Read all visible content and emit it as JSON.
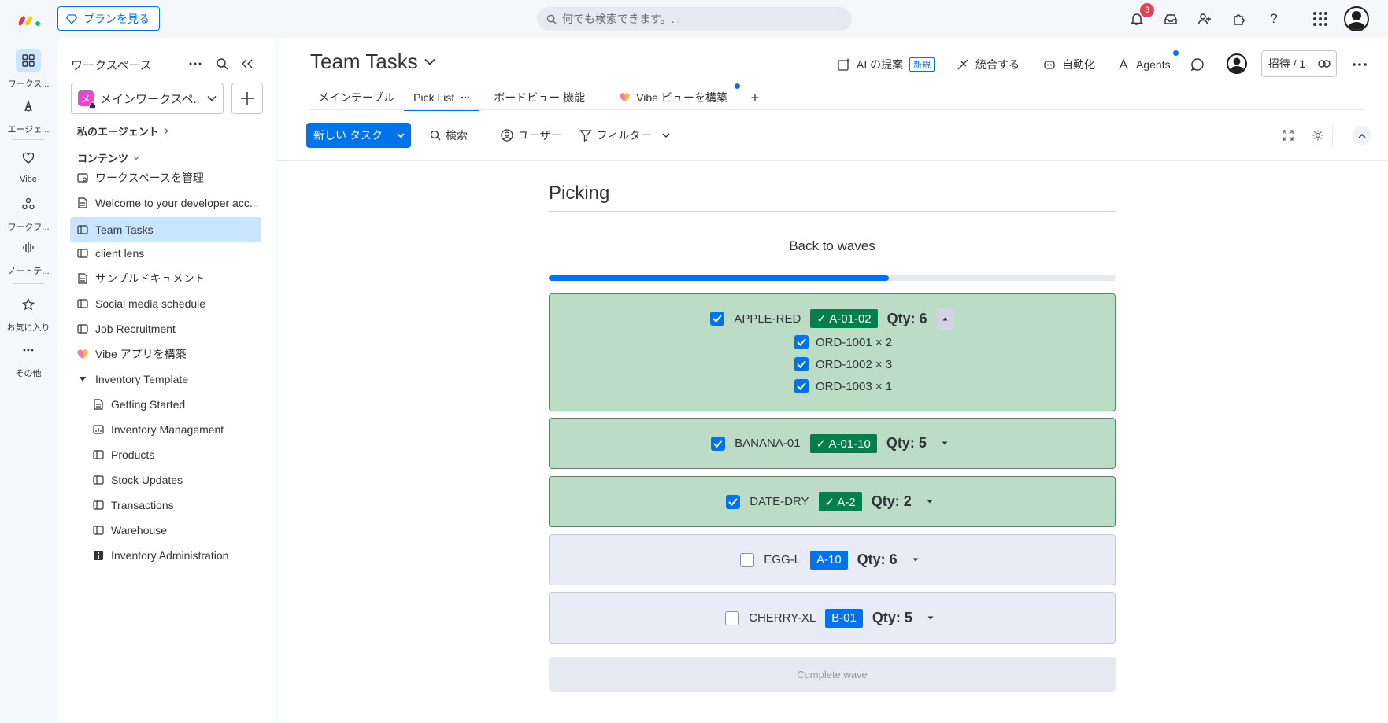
{
  "topbar": {
    "plans_label": "プランを見る",
    "search_placeholder": "何でも検索できます。. .",
    "notification_count": "3",
    "help_label": "?"
  },
  "rail": {
    "items": [
      {
        "label": "ワークス..."
      },
      {
        "label": "エージェ..."
      },
      {
        "label": "Vibe"
      },
      {
        "label": "ワークフ..."
      },
      {
        "label": "ノートテ..."
      },
      {
        "label": "お気に入り"
      },
      {
        "label": "その他"
      }
    ]
  },
  "workspace": {
    "title": "ワークスペース",
    "selected": "メインワークスペ...",
    "badge_letter": "メ",
    "agents_section": "私のエージェント",
    "contents_section": "コンテンツ",
    "items": [
      {
        "label": "ワークスペースを管理"
      },
      {
        "label": "Welcome to your developer acc..."
      },
      {
        "label": "Team Tasks"
      },
      {
        "label": "client lens"
      },
      {
        "label": "サンプルドキュメント"
      },
      {
        "label": "Social media schedule"
      },
      {
        "label": "Job Recruitment"
      },
      {
        "label": "Vibe アプリを構築"
      },
      {
        "label": "Inventory Template"
      }
    ],
    "sub_items": [
      {
        "label": "Getting Started"
      },
      {
        "label": "Inventory Management"
      },
      {
        "label": "Products"
      },
      {
        "label": "Stock Updates"
      },
      {
        "label": "Transactions"
      },
      {
        "label": "Warehouse"
      },
      {
        "label": "Inventory Administration"
      }
    ]
  },
  "board": {
    "title": "Team Tasks",
    "actions": {
      "ai": "AI の提案",
      "new_tag": "新規",
      "integrate": "統合する",
      "automate": "自動化",
      "agents": "Agents"
    },
    "invite_label": "招待 / 1",
    "tabs": [
      {
        "label": "メインテーブル"
      },
      {
        "label": "Pick List"
      },
      {
        "label": "ボードビュー 機能"
      },
      {
        "label": "Vibe ビューを構築"
      }
    ],
    "toolbar": {
      "new_task": "新しい タスク",
      "search": "検索",
      "user": "ユーザー",
      "filter": "フィルター"
    }
  },
  "picking": {
    "title": "Picking",
    "back_label": "Back to waves",
    "progress": 0.6,
    "items": [
      {
        "sku": "APPLE-RED",
        "location": "✓ A-01-02",
        "qty": "Qty: 6",
        "picked": true,
        "orders": [
          {
            "label": "ORD-1001 × 2"
          },
          {
            "label": "ORD-1002 × 3"
          },
          {
            "label": "ORD-1003 × 1"
          }
        ]
      },
      {
        "sku": "BANANA-01",
        "location": "✓ A-01-10",
        "qty": "Qty: 5",
        "picked": true
      },
      {
        "sku": "DATE-DRY",
        "location": "✓ A-2",
        "qty": "Qty: 2",
        "picked": true
      },
      {
        "sku": "EGG-L",
        "location": "A-10",
        "qty": "Qty: 6",
        "picked": false
      },
      {
        "sku": "CHERRY-XL",
        "location": "B-01",
        "qty": "Qty: 5",
        "picked": false
      }
    ],
    "complete_label": "Complete wave"
  }
}
